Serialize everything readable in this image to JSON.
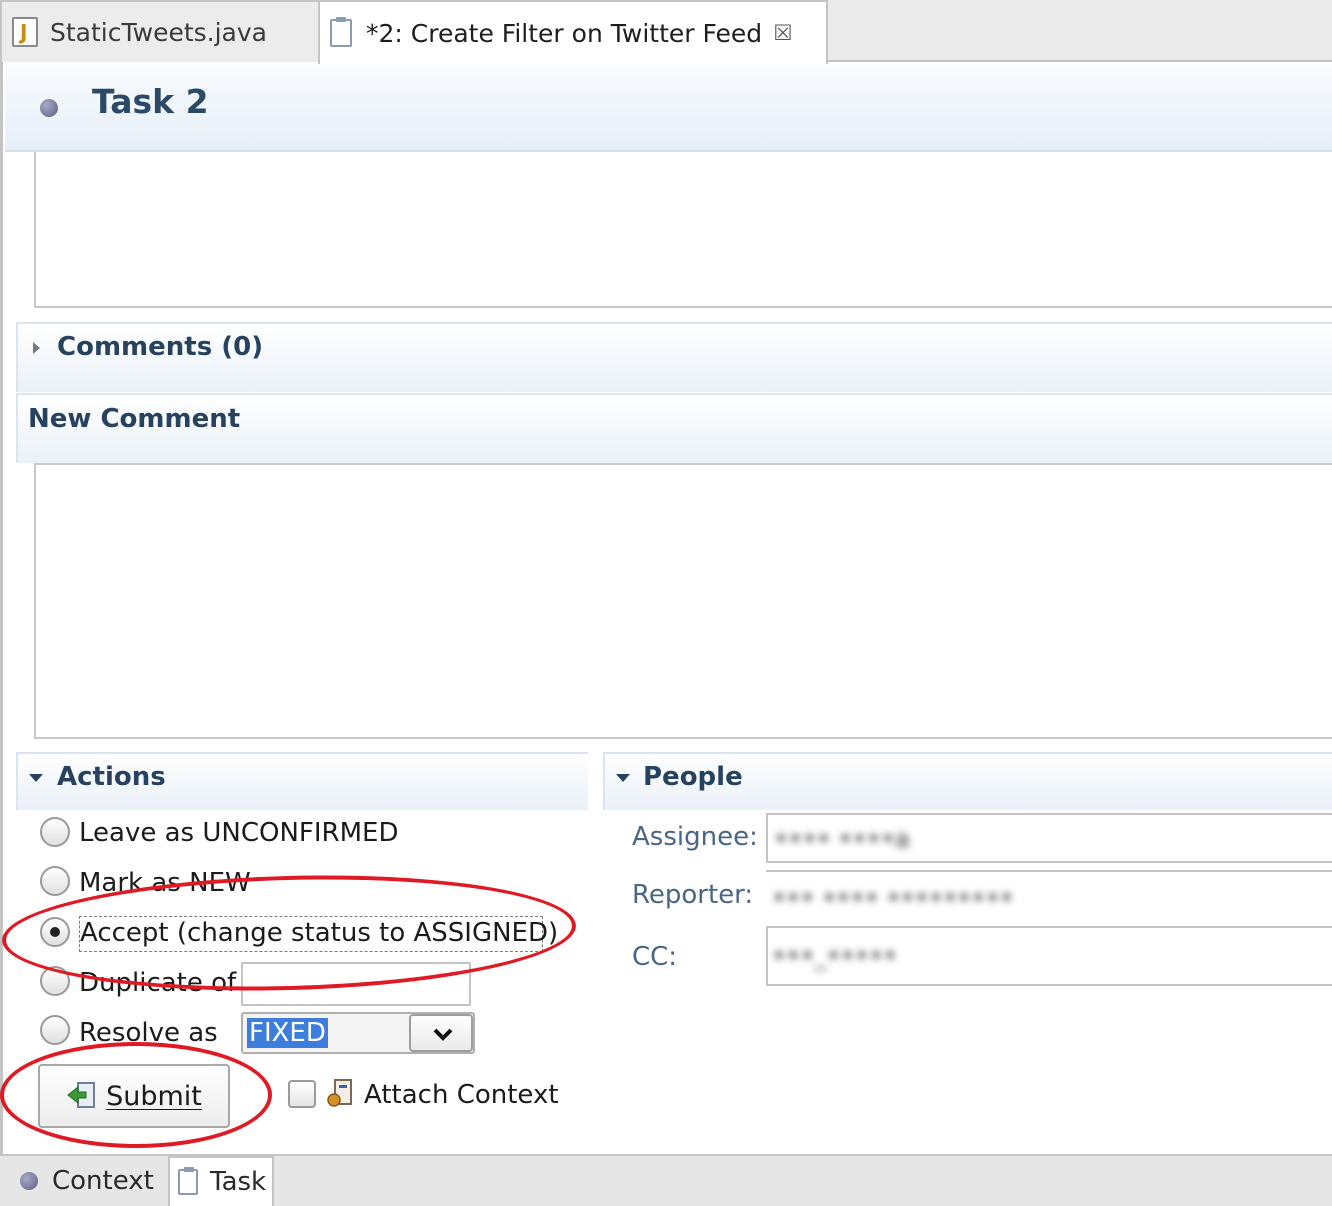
{
  "tabs": [
    {
      "label": "StaticTweets.java",
      "icon": "java-file-icon"
    },
    {
      "label": "*2: Create Filter on Twitter Feed",
      "icon": "task-icon"
    }
  ],
  "header": {
    "title": "Task 2"
  },
  "sections": {
    "comments": "Comments (0)",
    "new_comment": "New Comment",
    "actions": "Actions",
    "people": "People"
  },
  "actions": {
    "options": [
      {
        "label": "Leave as UNCONFIRMED",
        "checked": false
      },
      {
        "label": "Mark as NEW",
        "checked": false
      },
      {
        "label": "Accept (change status to ASSIGNED)",
        "checked": true
      },
      {
        "label": "Duplicate of",
        "checked": false
      },
      {
        "label": "Resolve as",
        "checked": false
      }
    ],
    "duplicate_of_value": "",
    "resolve_value": "FIXED",
    "submit_label": "Submit",
    "attach_context_label": "Attach Context",
    "attach_context_checked": false
  },
  "people": {
    "assignee_label": "Assignee:",
    "reporter_label": "Reporter:",
    "cc_label": "CC:",
    "assignee_value": "•••• ••••a",
    "reporter_value": "••• •••• •••••••••",
    "cc_value": "•••_•••••"
  },
  "bottom_tabs": [
    {
      "label": "Context",
      "active": false
    },
    {
      "label": "Task",
      "active": true
    }
  ],
  "colors": {
    "annotation": "#e01a24",
    "section_title": "#27425e",
    "selection": "#3d7ddb"
  }
}
